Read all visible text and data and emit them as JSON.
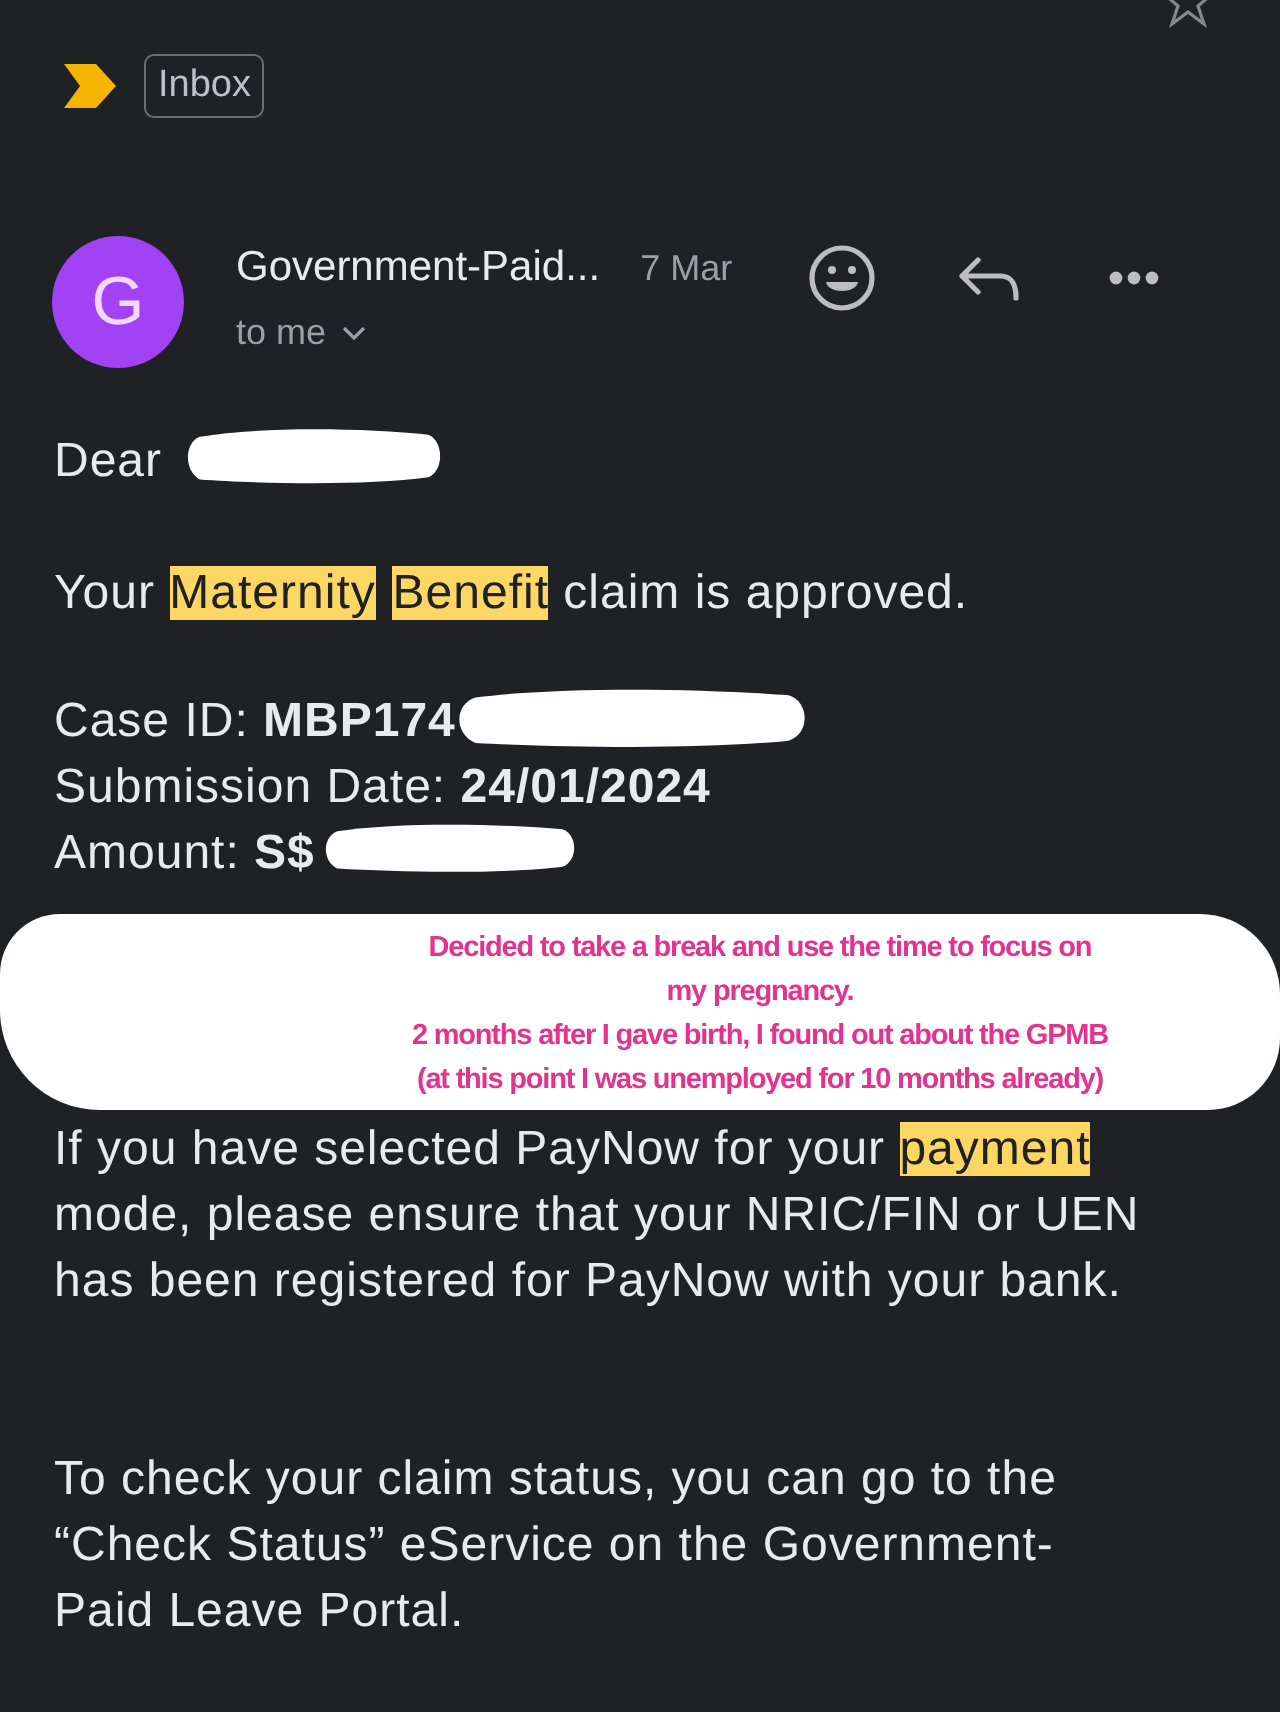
{
  "header": {
    "label_chip": "Inbox",
    "starred": false
  },
  "message": {
    "avatar_letter": "G",
    "sender": "Government-Paid...",
    "date": "7 Mar",
    "recipient": "to me"
  },
  "body": {
    "greeting": {
      "text": "Dear",
      "redacted": true
    },
    "intro": [
      {
        "text": "Your ",
        "highlighted": false
      },
      {
        "text": "Maternity",
        "highlighted": true
      },
      {
        "text": "Benefit",
        "highlighted": true
      },
      {
        "text": " claim is approved.",
        "highlighted": false
      }
    ],
    "details": [
      {
        "label": "Case ID:",
        "value": "MBP174",
        "redacted": true
      },
      {
        "label": "Submission Date:",
        "value": "24/01/2024",
        "redacted": false
      },
      {
        "label": "Amount:",
        "value": "S$",
        "redacted": true
      }
    ],
    "annotation": {
      "lines": [
        "Decided to take a break and use the time to focus on",
        "my pregnancy.",
        "2 months after I gave birth, I found out about the GPMB",
        "(at this point I was unemployed for 10 months already)"
      ]
    },
    "paragraphs": [
      [
        [
          {
            "text": "If you have selected PayNow for your ",
            "highlighted": false
          },
          {
            "text": "payment",
            "highlighted": true
          }
        ],
        [
          {
            "text": "mode, please ensure that your NRIC/FIN or UEN",
            "highlighted": false
          }
        ],
        [
          {
            "text": "has been registered for PayNow with your bank.",
            "highlighted": false
          }
        ]
      ],
      [
        [
          {
            "text": "To check your claim status, you can go to the",
            "highlighted": false
          }
        ],
        [
          {
            "text": "“Check Status” eService on the Government-",
            "highlighted": false
          }
        ],
        [
          {
            "text": "Paid Leave Portal.",
            "highlighted": false
          }
        ]
      ]
    ]
  }
}
